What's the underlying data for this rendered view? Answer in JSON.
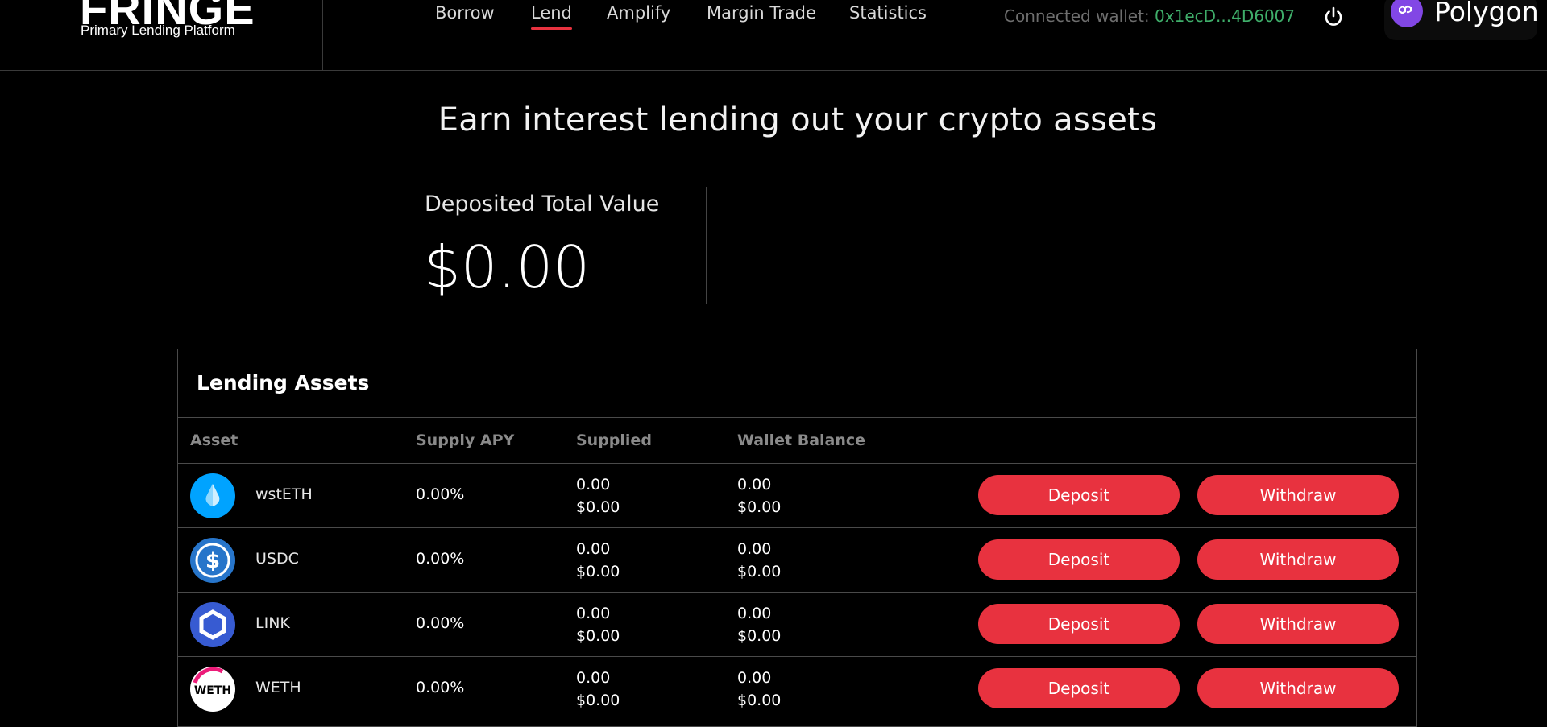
{
  "brand": {
    "name": "FRINGE",
    "tagline": "Primary Lending Platform"
  },
  "nav": {
    "items": [
      {
        "label": "Borrow",
        "active": false
      },
      {
        "label": "Lend",
        "active": true
      },
      {
        "label": "Amplify",
        "active": false
      },
      {
        "label": "Margin Trade",
        "active": false
      },
      {
        "label": "Statistics",
        "active": false
      }
    ]
  },
  "wallet": {
    "label": "Connected wallet: ",
    "address": "0x1ecD...4D6007"
  },
  "network": {
    "label": "Polygon",
    "icon": "polygon-icon"
  },
  "hero": {
    "title": "Earn interest lending out your crypto assets",
    "total_label": "Deposited Total Value",
    "total_value": "$0.00"
  },
  "table": {
    "title": "Lending Assets",
    "columns": [
      "Asset",
      "Supply APY",
      "Supplied",
      "Wallet Balance"
    ],
    "deposit_label": "Deposit",
    "withdraw_label": "Withdraw",
    "rows": [
      {
        "asset": "wstETH",
        "icon": "wsteth-icon",
        "apy": "0.00%",
        "supplied_amount": "0.00",
        "supplied_usd": "$0.00",
        "balance_amount": "0.00",
        "balance_usd": "$0.00"
      },
      {
        "asset": "USDC",
        "icon": "usdc-icon",
        "apy": "0.00%",
        "supplied_amount": "0.00",
        "supplied_usd": "$0.00",
        "balance_amount": "0.00",
        "balance_usd": "$0.00"
      },
      {
        "asset": "LINK",
        "icon": "link-icon",
        "apy": "0.00%",
        "supplied_amount": "0.00",
        "supplied_usd": "$0.00",
        "balance_amount": "0.00",
        "balance_usd": "$0.00"
      },
      {
        "asset": "WETH",
        "icon": "weth-icon",
        "apy": "0.00%",
        "supplied_amount": "0.00",
        "supplied_usd": "$0.00",
        "balance_amount": "0.00",
        "balance_usd": "$0.00"
      }
    ]
  },
  "colors": {
    "accent": "#e8323f",
    "wallet_address": "#3fae6a",
    "polygon": "#8247e5"
  }
}
